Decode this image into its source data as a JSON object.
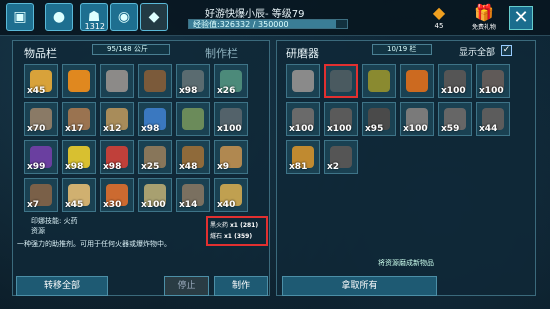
{
  "topbar": {
    "level_badge": "1312",
    "title": "好游快爆小辰- 等级79",
    "xp_label": "经验值:326332 / 350000",
    "xp_progress": 0.932,
    "gems_count": "45",
    "gift_label": "免费礼物",
    "close_label": "✕"
  },
  "inventory": {
    "tab_label": "物品栏",
    "craft_tab_label": "制作栏",
    "capacity": "95/148 公斤",
    "items": [
      {
        "qty": "x45",
        "color": "#d8a23a"
      },
      {
        "qty": "",
        "color": "#e0881f"
      },
      {
        "qty": "",
        "color": "#8c8a88"
      },
      {
        "qty": "",
        "color": "#7b5a3a"
      },
      {
        "qty": "x98",
        "color": "#5a6b70"
      },
      {
        "qty": "x26",
        "color": "#4c8a7a"
      },
      {
        "qty": "x70",
        "color": "#8a7a66"
      },
      {
        "qty": "x17",
        "color": "#9a7350"
      },
      {
        "qty": "x12",
        "color": "#a88c5a"
      },
      {
        "qty": "x98",
        "color": "#3a78c0"
      },
      {
        "qty": "",
        "color": "#6b8b5a"
      },
      {
        "qty": "x100",
        "color": "#53626a"
      },
      {
        "qty": "x99",
        "color": "#6a3fa0"
      },
      {
        "qty": "x98",
        "color": "#d8c030"
      },
      {
        "qty": "x98",
        "color": "#c0403a"
      },
      {
        "qty": "x25",
        "color": "#88765a"
      },
      {
        "qty": "x48",
        "color": "#8f6a3a"
      },
      {
        "qty": "x9",
        "color": "#b08850"
      },
      {
        "qty": "x7",
        "color": "#7a6048"
      },
      {
        "qty": "x45",
        "color": "#d0b070"
      },
      {
        "qty": "x30",
        "color": "#cc6a30"
      },
      {
        "qty": "x100",
        "color": "#a8a070"
      },
      {
        "qty": "x14",
        "color": "#7a7060"
      },
      {
        "qty": "x40",
        "color": "#c0a050"
      }
    ],
    "info_title": "印娜技能: 火药",
    "info_sub": "资源",
    "info_desc": "一种强力的助推剂。可用于任何火器或爆炸物中。",
    "req1_label": "黑火药",
    "req1_val": "x1 (281)",
    "req2_label": "燧石",
    "req2_val": "x1 (359)",
    "transfer_all": "转移全部",
    "stop": "停止",
    "craft": "制作"
  },
  "grinder": {
    "title": "研磨器",
    "capacity": "10/19 栏",
    "show_all": "显示全部",
    "check": "✓",
    "items": [
      {
        "qty": "",
        "color": "#8a8a8a"
      },
      {
        "qty": "",
        "color": "#4a5a60"
      },
      {
        "qty": "",
        "color": "#8a8a30"
      },
      {
        "qty": "",
        "color": "#cc6a20"
      },
      {
        "qty": "x100",
        "color": "#555"
      },
      {
        "qty": "x100",
        "color": "#605a58"
      },
      {
        "qty": "x100",
        "color": "#6a6a6a"
      },
      {
        "qty": "x100",
        "color": "#5a5a5a"
      },
      {
        "qty": "x95",
        "color": "#4a4a4a"
      },
      {
        "qty": "x100",
        "color": "#7a7a7a"
      },
      {
        "qty": "x59",
        "color": "#666"
      },
      {
        "qty": "x44",
        "color": "#5c5c5c"
      },
      {
        "qty": "x81",
        "color": "#c08a30"
      },
      {
        "qty": "x2",
        "color": "#555"
      }
    ],
    "hint": "将资源磨成新物品",
    "take_all": "拿取所有"
  }
}
